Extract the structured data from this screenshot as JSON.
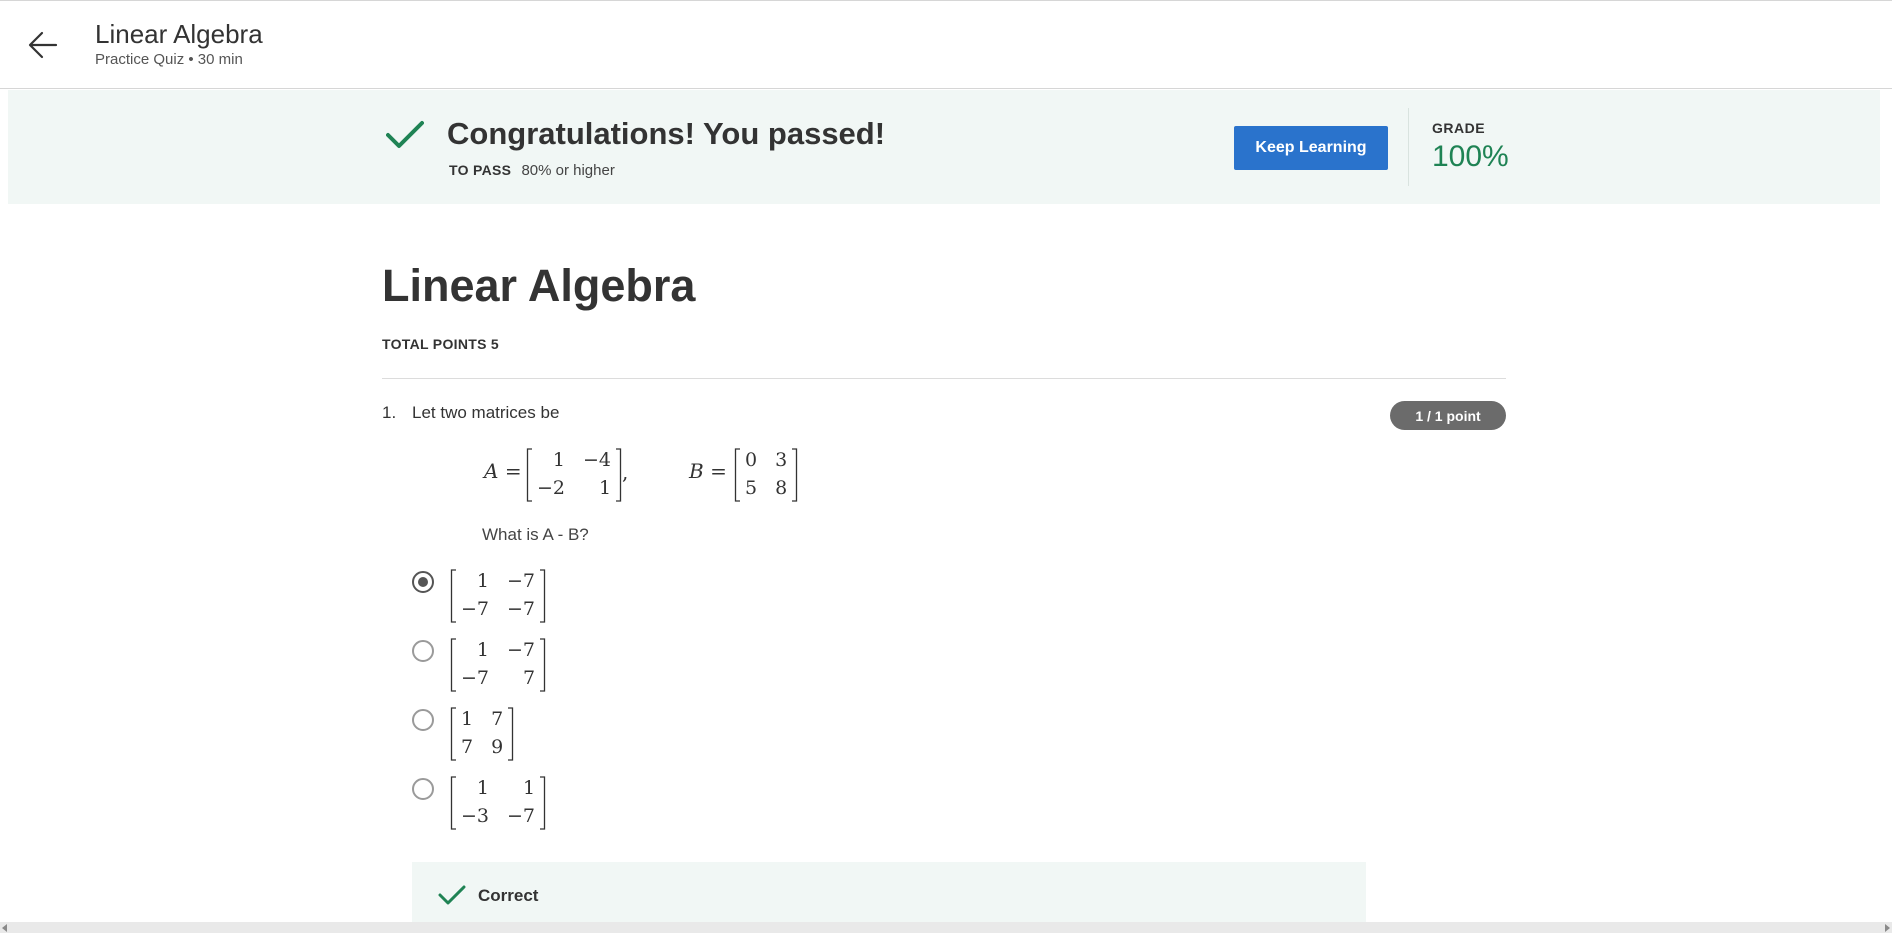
{
  "header": {
    "title": "Linear Algebra",
    "subtitle": "Practice Quiz • 30 min",
    "back_icon": "arrow-left-icon"
  },
  "banner": {
    "message": "Congratulations! You passed!",
    "to_pass_label": "TO PASS",
    "to_pass_value": "80% or higher",
    "keep_learning_label": "Keep Learning",
    "grade_label": "GRADE",
    "grade_value": "100%",
    "icon": "checkmark-icon"
  },
  "quiz": {
    "title": "Linear Algebra",
    "total_points": "TOTAL POINTS 5",
    "questions": [
      {
        "number": "1.",
        "text": "Let two matrices be",
        "points_badge": "1 / 1 point",
        "matrix_A": {
          "name": "A",
          "rows": [
            [
              "1",
              "−4"
            ],
            [
              "−2",
              "1"
            ]
          ]
        },
        "matrix_B": {
          "name": "B",
          "rows": [
            [
              "0",
              "3"
            ],
            [
              "5",
              "8"
            ]
          ]
        },
        "equals": "=",
        "comma": ",",
        "sub_question": "What is A - B?",
        "options": [
          {
            "rows": [
              [
                "1",
                "−7"
              ],
              [
                "−7",
                "−7"
              ]
            ],
            "selected": true
          },
          {
            "rows": [
              [
                "1",
                "−7"
              ],
              [
                "−7",
                "7"
              ]
            ],
            "selected": false
          },
          {
            "rows": [
              [
                "1",
                "7"
              ],
              [
                "7",
                "9"
              ]
            ],
            "selected": false
          },
          {
            "rows": [
              [
                "1",
                "1"
              ],
              [
                "−3",
                "−7"
              ]
            ],
            "selected": false
          }
        ],
        "feedback": "Correct"
      }
    ]
  },
  "colors": {
    "accent_blue": "#2a73cc",
    "success_green": "#1f8354",
    "banner_bg": "#f1f7f5",
    "badge_gray": "#6b6b6b"
  }
}
